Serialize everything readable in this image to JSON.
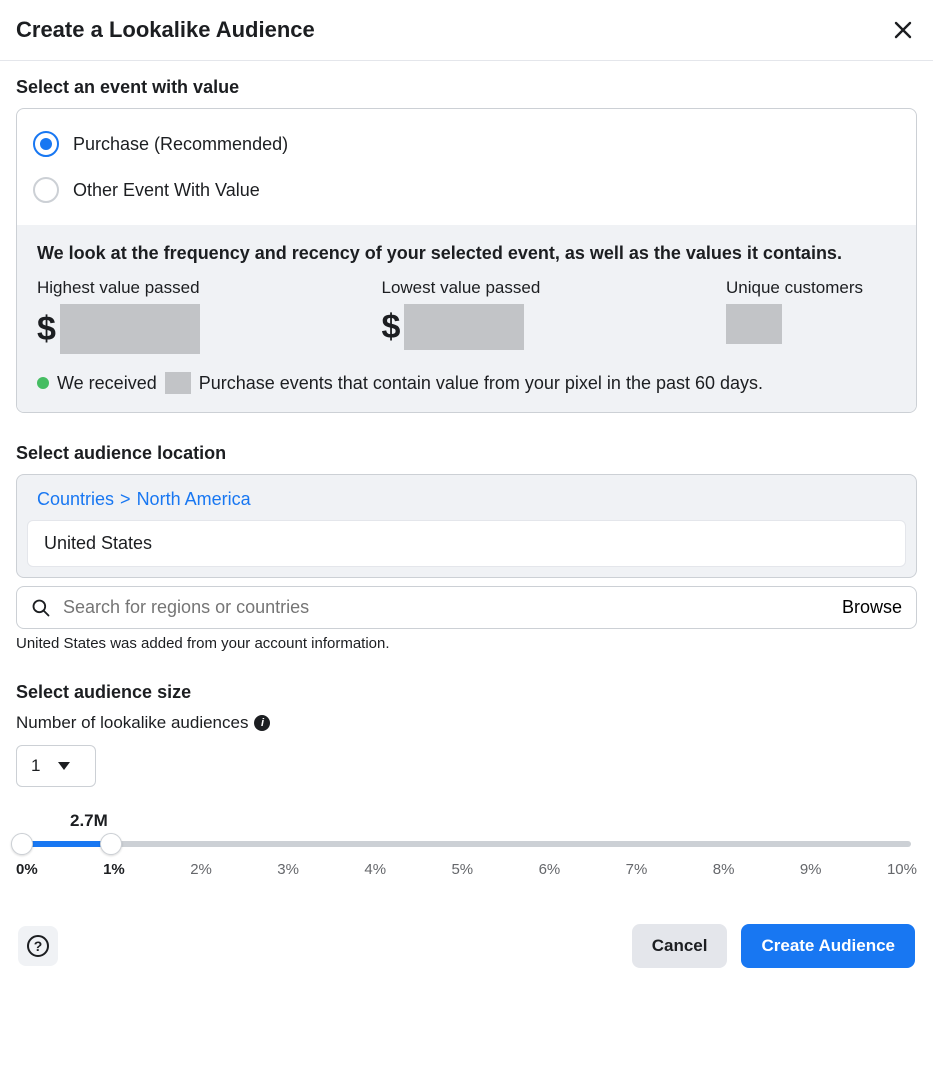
{
  "header": {
    "title": "Create a Lookalike Audience"
  },
  "event_section": {
    "title": "Select an event with value",
    "options": [
      {
        "label": "Purchase (Recommended)",
        "selected": true
      },
      {
        "label": "Other Event With Value",
        "selected": false
      }
    ],
    "stats_heading": "We look at the frequency and recency of your selected event, as well as the values it contains.",
    "stats": {
      "highest_label": "Highest value passed",
      "lowest_label": "Lowest value passed",
      "unique_label": "Unique customers"
    },
    "summary_prefix": "We received",
    "summary_suffix": "Purchase events that contain value from your pixel in the past 60 days."
  },
  "location_section": {
    "title": "Select audience location",
    "breadcrumb": {
      "root": "Countries",
      "region": "North America"
    },
    "selected_tag": "United States",
    "search_placeholder": "Search for regions or countries",
    "browse_label": "Browse",
    "hint": "United States was added from your account information."
  },
  "size_section": {
    "title": "Select audience size",
    "subtitle": "Number of lookalike audiences",
    "count_value": "1",
    "estimate_label": "2.7M",
    "slider": {
      "low_pct": 0,
      "high_pct": 10
    },
    "ticks": [
      "0%",
      "1%",
      "2%",
      "3%",
      "4%",
      "5%",
      "6%",
      "7%",
      "8%",
      "9%",
      "10%"
    ]
  },
  "footer": {
    "cancel": "Cancel",
    "create": "Create Audience"
  }
}
